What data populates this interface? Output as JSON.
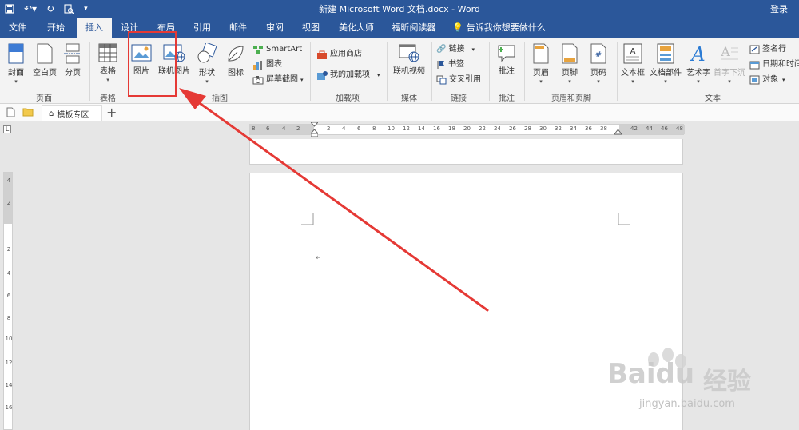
{
  "window": {
    "title": "新建 Microsoft Word 文档.docx - Word",
    "login": "登录"
  },
  "tabs": [
    {
      "label": "文件"
    },
    {
      "label": "开始"
    },
    {
      "label": "插入",
      "active": true
    },
    {
      "label": "设计"
    },
    {
      "label": "布局"
    },
    {
      "label": "引用"
    },
    {
      "label": "邮件"
    },
    {
      "label": "审阅"
    },
    {
      "label": "视图"
    },
    {
      "label": "美化大师"
    },
    {
      "label": "福昕阅读器"
    }
  ],
  "tellme": "告诉我你想要做什么",
  "ribbon": {
    "pages": {
      "label": "页面",
      "cover": "封面",
      "blank": "空白页",
      "break": "分页"
    },
    "tables": {
      "label": "表格",
      "table": "表格"
    },
    "illustrations": {
      "label": "插图",
      "picture": "图片",
      "online_picture": "联机图片",
      "shapes": "形状",
      "icons": "图标",
      "smartart": "SmartArt",
      "chart": "图表",
      "screenshot": "屏幕截图"
    },
    "addins": {
      "label": "加载项",
      "store": "应用商店",
      "my_addins": "我的加载项"
    },
    "media": {
      "label": "媒体",
      "online_video": "联机视频"
    },
    "links": {
      "label": "链接",
      "link": "链接",
      "bookmark": "书签",
      "crossref": "交叉引用"
    },
    "comments": {
      "label": "批注",
      "comment": "批注"
    },
    "headerfooter": {
      "label": "页眉和页脚",
      "header": "页眉",
      "footer": "页脚",
      "pagenum": "页码"
    },
    "text": {
      "label": "文本",
      "textbox": "文本框",
      "quickparts": "文档部件",
      "wordart": "艺术字",
      "dropcap": "首字下沉",
      "signature": "签名行",
      "datetime": "日期和时间",
      "object": "对象"
    }
  },
  "doc_tab": {
    "label": "模板专区"
  },
  "ruler": {
    "h_ticks": [
      "8",
      "6",
      "4",
      "2",
      "2",
      "4",
      "6",
      "8",
      "10",
      "12",
      "14",
      "16",
      "18",
      "20",
      "22",
      "24",
      "26",
      "28",
      "30",
      "32",
      "34",
      "36",
      "38",
      "42",
      "44",
      "46",
      "48"
    ],
    "v_ticks": [
      "4",
      "2",
      "2",
      "4",
      "6",
      "8",
      "10",
      "12",
      "14",
      "16"
    ]
  },
  "watermark": {
    "brand": "Baidu",
    "cn": "经验",
    "url": "jingyan.baidu.com"
  },
  "colors": {
    "accent": "#2b579a",
    "highlight": "#e53935"
  }
}
